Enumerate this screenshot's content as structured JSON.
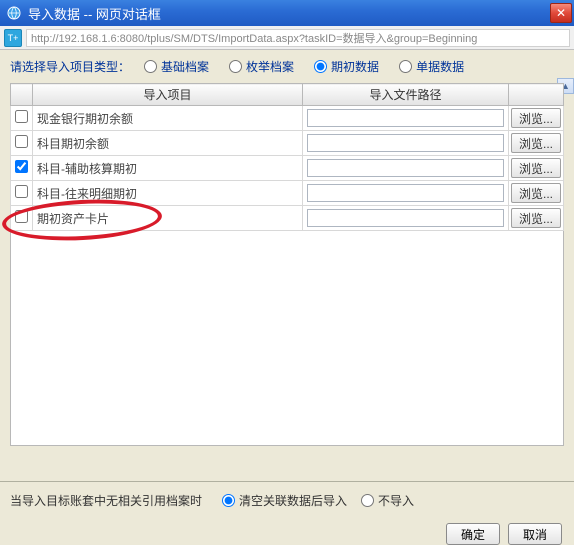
{
  "titlebar": {
    "title": "导入数据 -- 网页对话框",
    "close_symbol": "✕"
  },
  "urlbar": {
    "app_icon_text": "T+",
    "url": "http://192.168.1.6:8080/tplus/SM/DTS/ImportData.aspx?taskID=数据导入&group=Beginning"
  },
  "type_row": {
    "label": "请选择导入项目类型：",
    "options": [
      "基础档案",
      "枚举档案",
      "期初数据",
      "单据数据"
    ],
    "selected_index": 2
  },
  "table": {
    "headers": {
      "cb": "",
      "item": "导入项目",
      "path": "导入文件路径",
      "btn": ""
    },
    "browse_label": "浏览...",
    "rows": [
      {
        "checked": false,
        "label": "现金银行期初余额",
        "path": ""
      },
      {
        "checked": false,
        "label": "科目期初余额",
        "path": ""
      },
      {
        "checked": true,
        "label": "科目-辅助核算期初",
        "path": ""
      },
      {
        "checked": false,
        "label": "科目-往来明细期初",
        "path": ""
      },
      {
        "checked": false,
        "label": "期初资产卡片",
        "path": ""
      }
    ]
  },
  "footer": {
    "no_ref_label": "当导入目标账套中无相关引用档案时",
    "options": [
      "清空关联数据后导入",
      "不导入"
    ],
    "selected_index": 0,
    "ok_label": "确定",
    "cancel_label": "取消"
  },
  "scroll_up_glyph": "▲"
}
